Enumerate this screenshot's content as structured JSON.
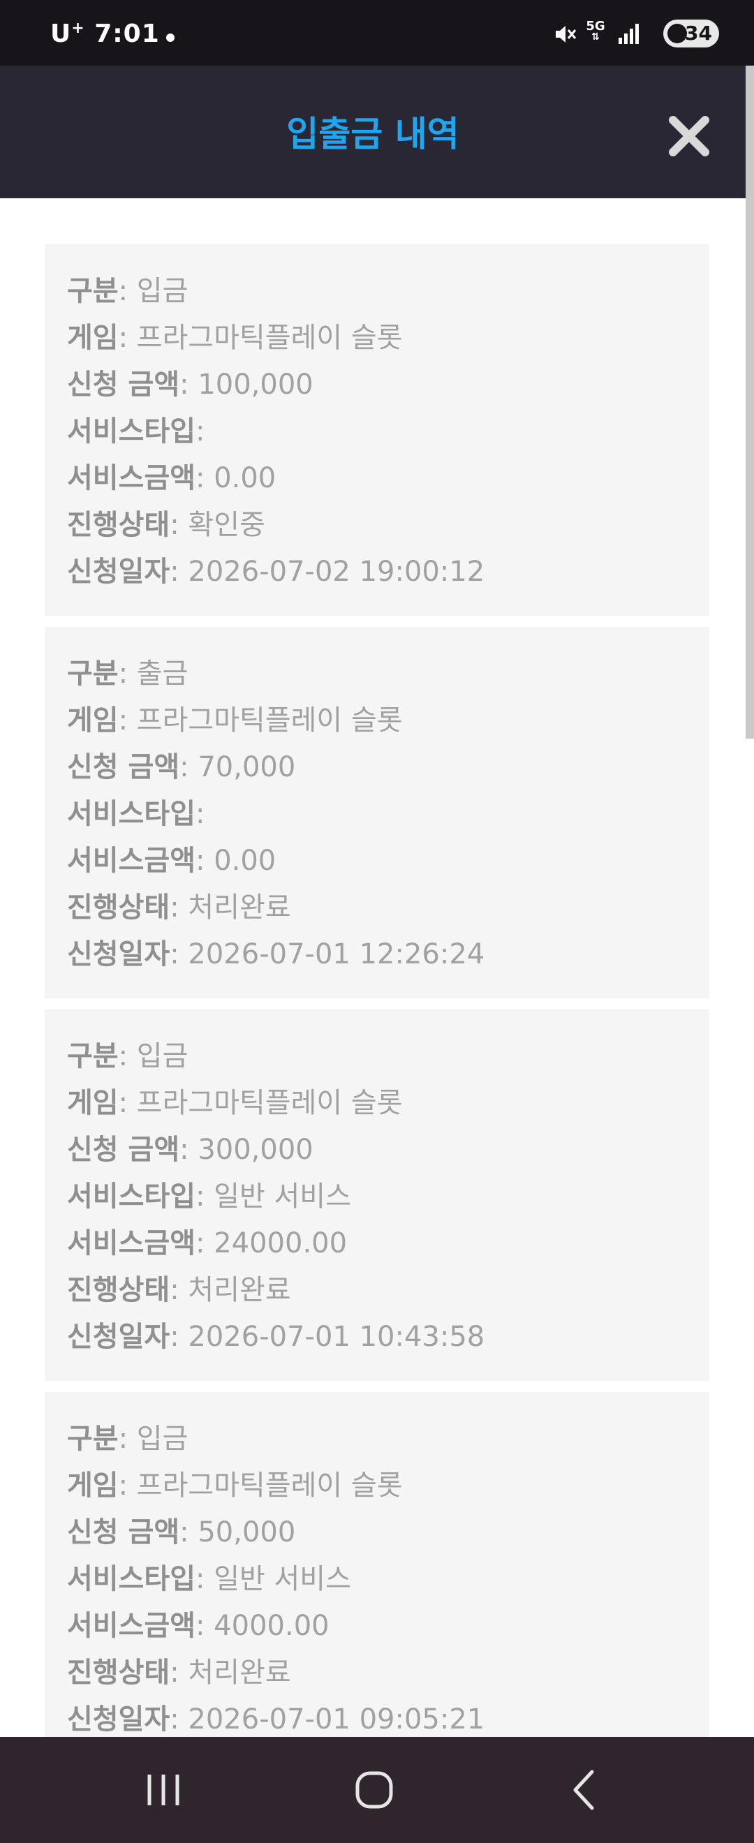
{
  "status_bar": {
    "carrier": "U",
    "carrier_sup": "+",
    "time": "7:01",
    "network": "5G",
    "battery": "34"
  },
  "header": {
    "title": "입출금 내역"
  },
  "records": [
    {
      "type_label": "구분",
      "type_value": ": 입금",
      "game_label": "게임",
      "game_value": ": 프라그마틱플레이 슬롯",
      "amount_label": "신청 금액",
      "amount_value": ": 100,000",
      "service_type_label": "서비스타입",
      "service_type_value": ":",
      "service_amount_label": "서비스금액",
      "service_amount_value": ": 0.00",
      "status_label": "진행상태",
      "status_value": ": 확인중",
      "date_label": "신청일자",
      "date_value": ": 2026-07-02 19:00:12"
    },
    {
      "type_label": "구분",
      "type_value": ": 출금",
      "game_label": "게임",
      "game_value": ": 프라그마틱플레이 슬롯",
      "amount_label": "신청 금액",
      "amount_value": ": 70,000",
      "service_type_label": "서비스타입",
      "service_type_value": ":",
      "service_amount_label": "서비스금액",
      "service_amount_value": ": 0.00",
      "status_label": "진행상태",
      "status_value": ": 처리완료",
      "date_label": "신청일자",
      "date_value": ": 2026-07-01 12:26:24"
    },
    {
      "type_label": "구분",
      "type_value": ": 입금",
      "game_label": "게임",
      "game_value": ": 프라그마틱플레이 슬롯",
      "amount_label": "신청 금액",
      "amount_value": ": 300,000",
      "service_type_label": "서비스타입",
      "service_type_value": ": 일반 서비스",
      "service_amount_label": "서비스금액",
      "service_amount_value": ": 24000.00",
      "status_label": "진행상태",
      "status_value": ": 처리완료",
      "date_label": "신청일자",
      "date_value": ": 2026-07-01 10:43:58"
    },
    {
      "type_label": "구분",
      "type_value": ": 입금",
      "game_label": "게임",
      "game_value": ": 프라그마틱플레이 슬롯",
      "amount_label": "신청 금액",
      "amount_value": ": 50,000",
      "service_type_label": "서비스타입",
      "service_type_value": ": 일반 서비스",
      "service_amount_label": "서비스금액",
      "service_amount_value": ": 4000.00",
      "status_label": "진행상태",
      "status_value": ": 처리완료",
      "date_label": "신청일자",
      "date_value": ": 2026-07-01 09:05:21"
    }
  ],
  "colors": {
    "header_bg": "#282733",
    "title_accent": "#1ea7f0",
    "card_bg": "#f5f5f5",
    "nav_bg": "#2f252d"
  },
  "icons": {
    "close": "close-icon",
    "recent_apps": "recent-apps-icon",
    "home": "home-icon",
    "back": "back-icon"
  }
}
